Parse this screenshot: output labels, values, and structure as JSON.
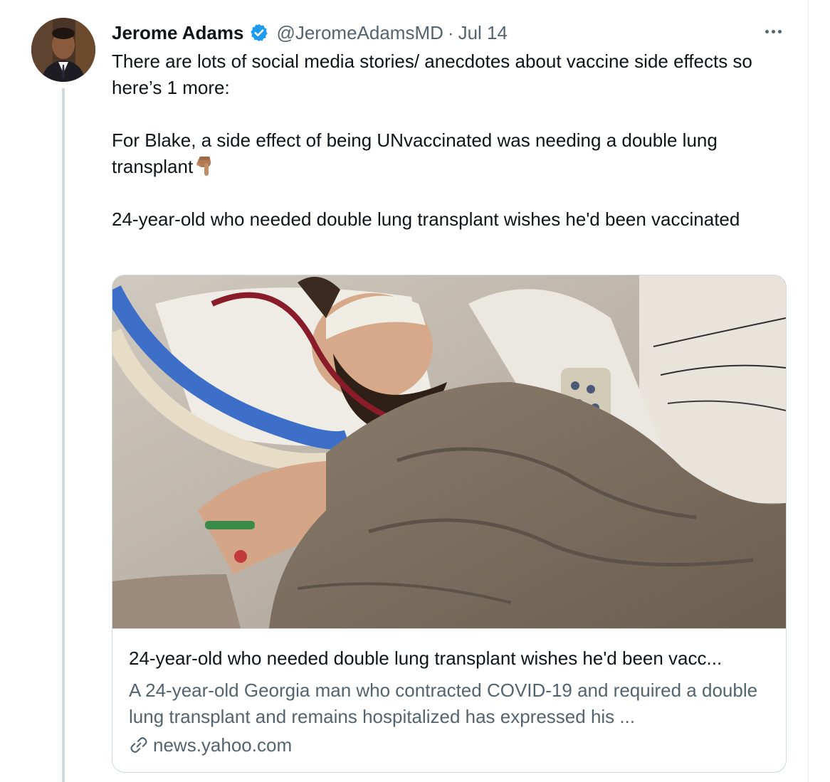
{
  "tweet": {
    "author_name": "Jerome Adams",
    "handle": "@JeromeAdamsMD",
    "separator": "·",
    "date": "Jul 14",
    "text_para1": "There are lots of social media stories/ anecdotes about vaccine side effects so here’s 1 more:",
    "text_para2": "For Blake, a side effect of being UNvaccinated was needing a double lung transplant",
    "text_para3": "24-year-old who needed double lung transplant wishes he'd been vaccinated",
    "emoji_icon": "backhand-index-pointing-down-emoji",
    "verified_icon": "verified-badge-icon",
    "more_icon": "more-options-icon"
  },
  "card": {
    "title": "24-year-old who needed double lung transplant wishes he'd been vacc...",
    "description": "A 24-year-old Georgia man who contracted COVID-19 and required a double lung transplant and remains hospitalized has expressed his ...",
    "domain": "news.yahoo.com",
    "image_description_icon": "hospital-patient-photo",
    "link_icon": "link-icon"
  },
  "colors": {
    "verified_blue": "#1d9bf0",
    "text_primary": "#0f1419",
    "text_secondary": "#536471",
    "border": "#cfd9de"
  }
}
